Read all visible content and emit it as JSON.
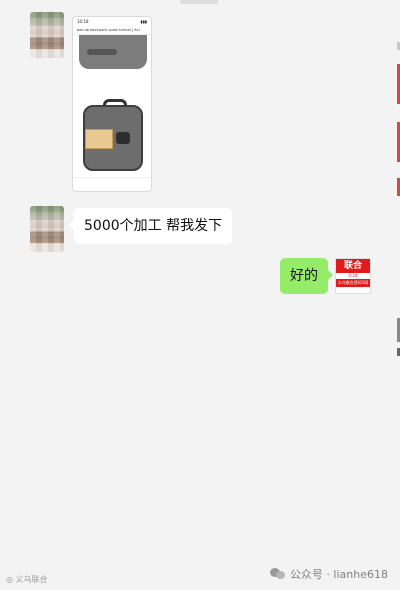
{
  "chat": {
    "messages": [
      {
        "side": "left",
        "type": "image",
        "text": ""
      },
      {
        "side": "left",
        "type": "text",
        "text": "5000个加工 帮我发下"
      },
      {
        "side": "right",
        "type": "text",
        "text": "好的"
      }
    ]
  },
  "screenshot_card": {
    "status_time": "10:18",
    "status_icons": "▮▮▮",
    "header_text": "bas de backpack quod animal | ALI",
    "line_text": "bas de backpack quod animal"
  },
  "logo": {
    "top": "联合",
    "mid": "0:24",
    "band": "义乌联合烫印1网",
    "bottom": ""
  },
  "watermarks": {
    "left_text": "◎ 义乌联合",
    "right_text": "公众号 · lianhe618"
  },
  "colors": {
    "background": "#f3f3f3",
    "bubble_left": "#ffffff",
    "bubble_right": "#95ec69",
    "logo_red": "#e11b1b"
  },
  "icons": {
    "watermark_icon": "wechat-logo-icon"
  }
}
